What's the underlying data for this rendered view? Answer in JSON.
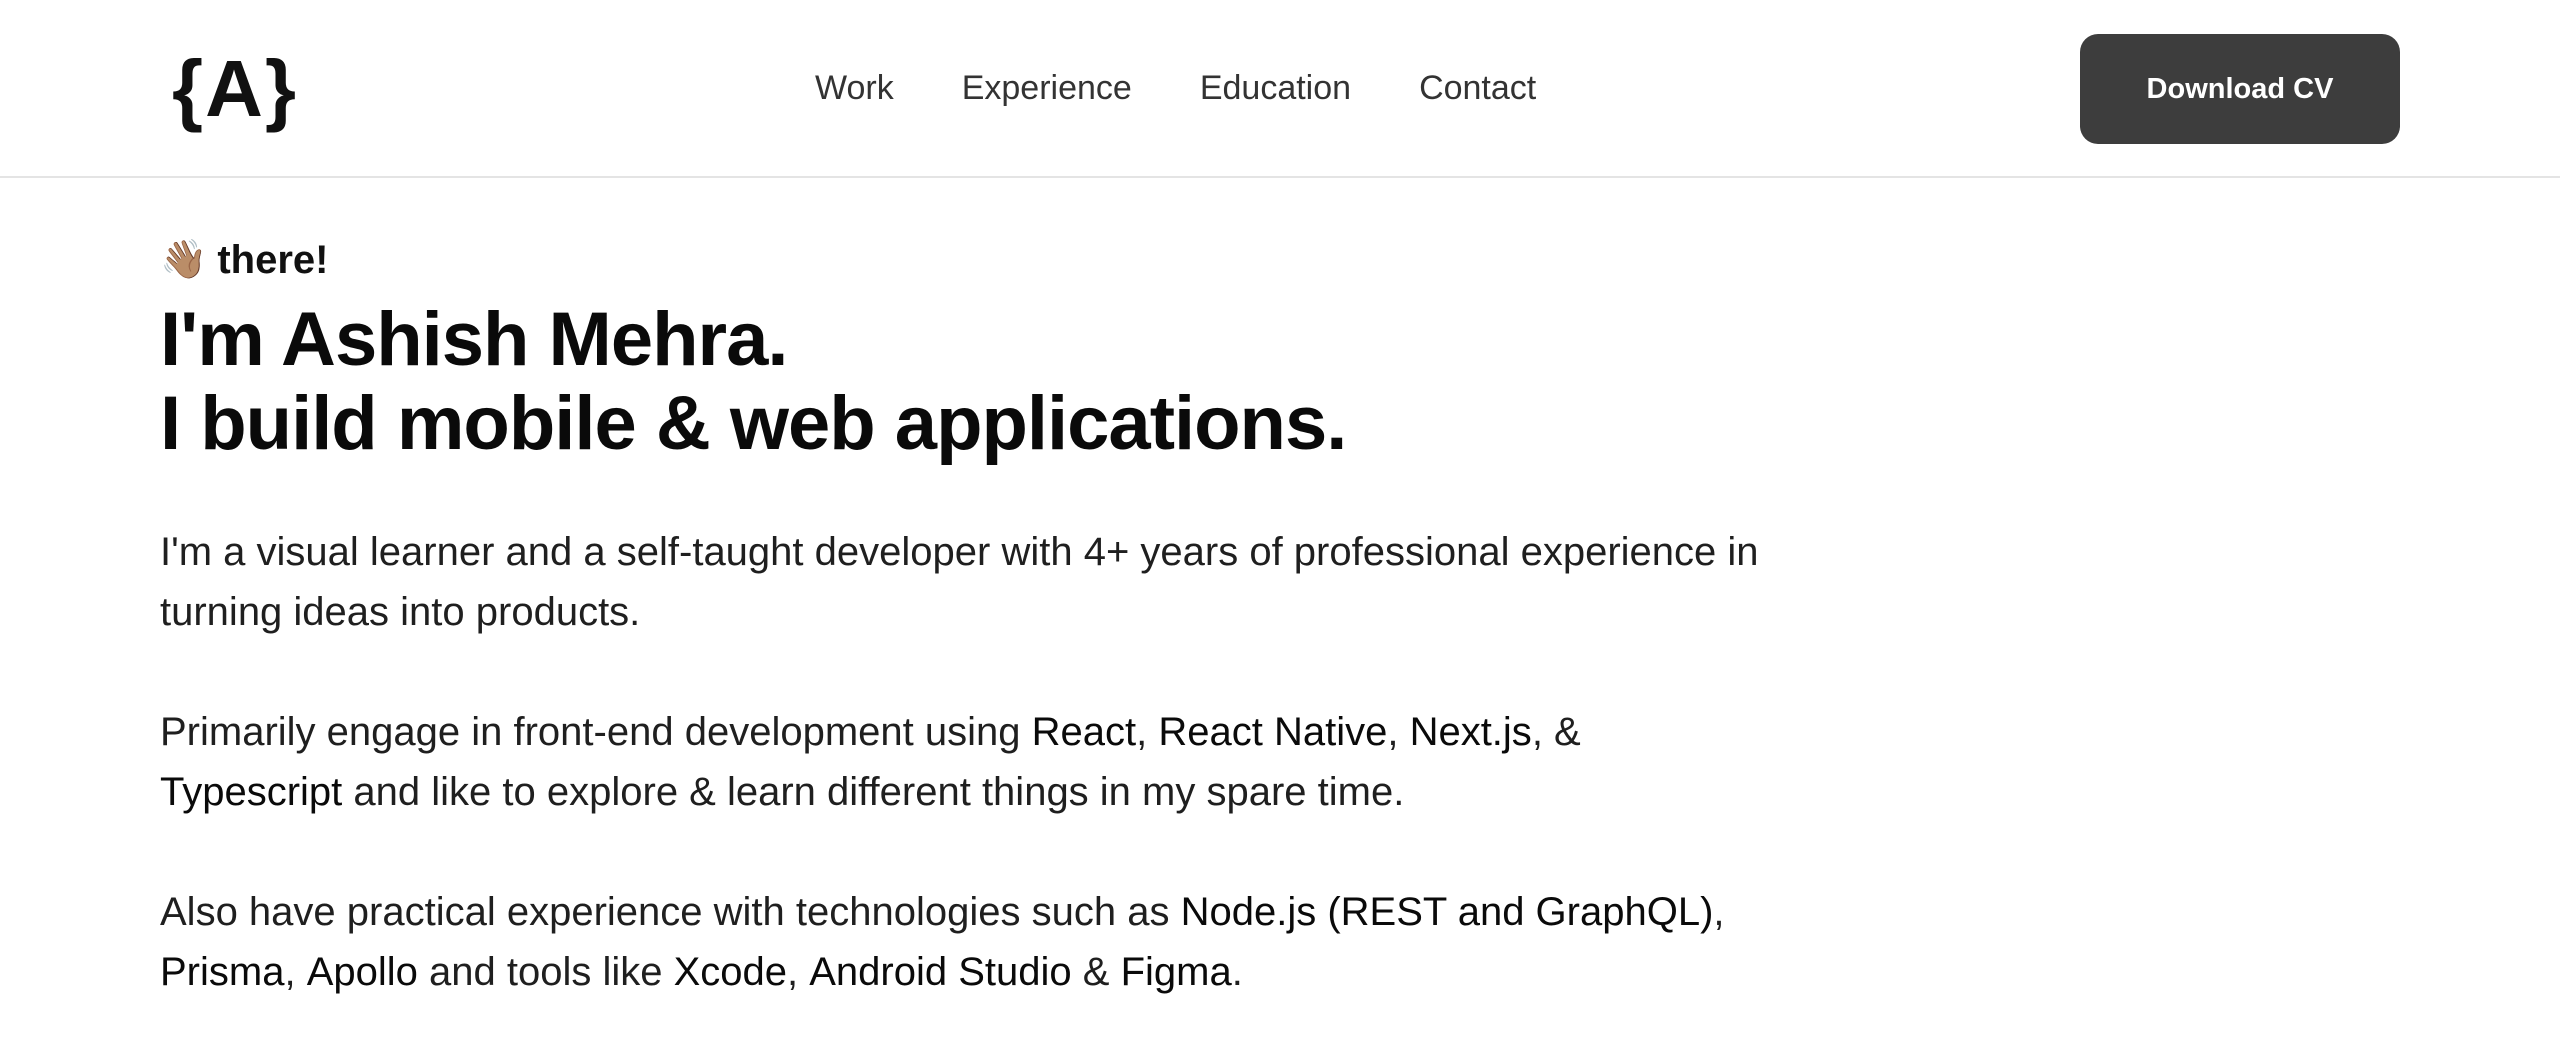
{
  "header": {
    "logo": "{A}",
    "nav": [
      {
        "label": "Work"
      },
      {
        "label": "Experience"
      },
      {
        "label": "Education"
      },
      {
        "label": "Contact"
      }
    ],
    "cta_label": "Download CV"
  },
  "hero": {
    "greeting_emoji": "👋🏽",
    "greeting_text": "there!",
    "headline_line1": "I'm Ashish Mehra.",
    "headline_line2": "I build mobile & web applications.",
    "paragraph1": "I'm a visual learner and a self-taught developer with 4+ years of professional experience in turning ideas into products.",
    "paragraph2": {
      "intro": "Primarily engage in front-end development using ",
      "tech1": "React",
      "sep1": ", ",
      "tech2": "React Native",
      "sep2": ", ",
      "tech3": "Next.js",
      "sep3": ", & ",
      "tech4": "Typescript",
      "outro": " and like to explore & learn different things in my spare time."
    },
    "paragraph3": {
      "intro": "Also have practical experience with technologies such as ",
      "tech1": "Node.js (REST and GraphQL)",
      "sep1": ", ",
      "tech2": "Prisma",
      "sep2": ", ",
      "tech3": "Apollo",
      "mid": " and tools like ",
      "tool1": "Xcode",
      "sep3": ", ",
      "tool2": "Android Studio",
      "sep4": " & ",
      "tool3": "Figma",
      "end": "."
    }
  }
}
